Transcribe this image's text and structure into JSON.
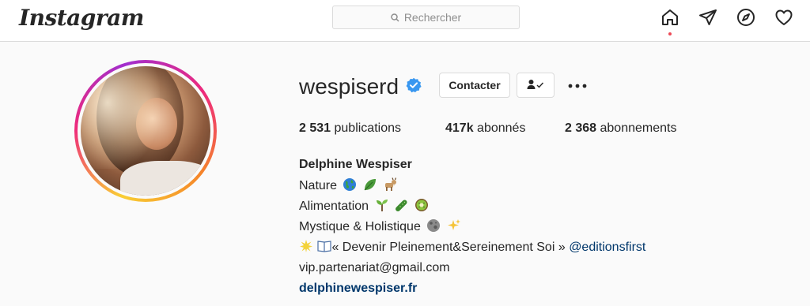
{
  "app": {
    "logo_text": "Instagram"
  },
  "search": {
    "placeholder": "Rechercher"
  },
  "nav": {
    "icons": [
      "home-icon",
      "direct-icon",
      "explore-icon",
      "activity-icon"
    ],
    "active": "home"
  },
  "profile": {
    "username": "wespiserd",
    "verified": true,
    "contact_label": "Contacter",
    "follow_icon": "person-check-icon",
    "more_icon": "more-dots-icon",
    "stats": {
      "posts_count": "2 531",
      "posts_label": "publications",
      "followers_count": "417k",
      "followers_label": "abonnés",
      "following_count": "2 368",
      "following_label": "abonnements"
    }
  },
  "bio": {
    "full_name": "Delphine Wespiser",
    "line1": {
      "text": "Nature",
      "emojis": [
        "globe-icon",
        "leaf-icon",
        "goat-icon"
      ]
    },
    "line2": {
      "text": "Alimentation",
      "emojis": [
        "seedling-icon",
        "cucumber-icon",
        "kiwi-icon"
      ]
    },
    "line3": {
      "text": "Mystique & Holistique",
      "emojis": [
        "moon-icon",
        "sparkles-icon"
      ]
    },
    "line4": {
      "prefix_emojis": [
        "sparkle-burst-icon",
        "book-icon"
      ],
      "text": "« Devenir Pleinement&Sereinement Soi »",
      "mention": "@editionsfirst"
    },
    "email": "vip.partenariat@gmail.com",
    "website": "delphinewespiser.fr"
  },
  "colors": {
    "accent": "#3897f0",
    "link": "#00376b",
    "notification_dot": "#ed4956",
    "text": "#262626",
    "muted": "#8e8e8e",
    "border": "#dbdbdb"
  }
}
